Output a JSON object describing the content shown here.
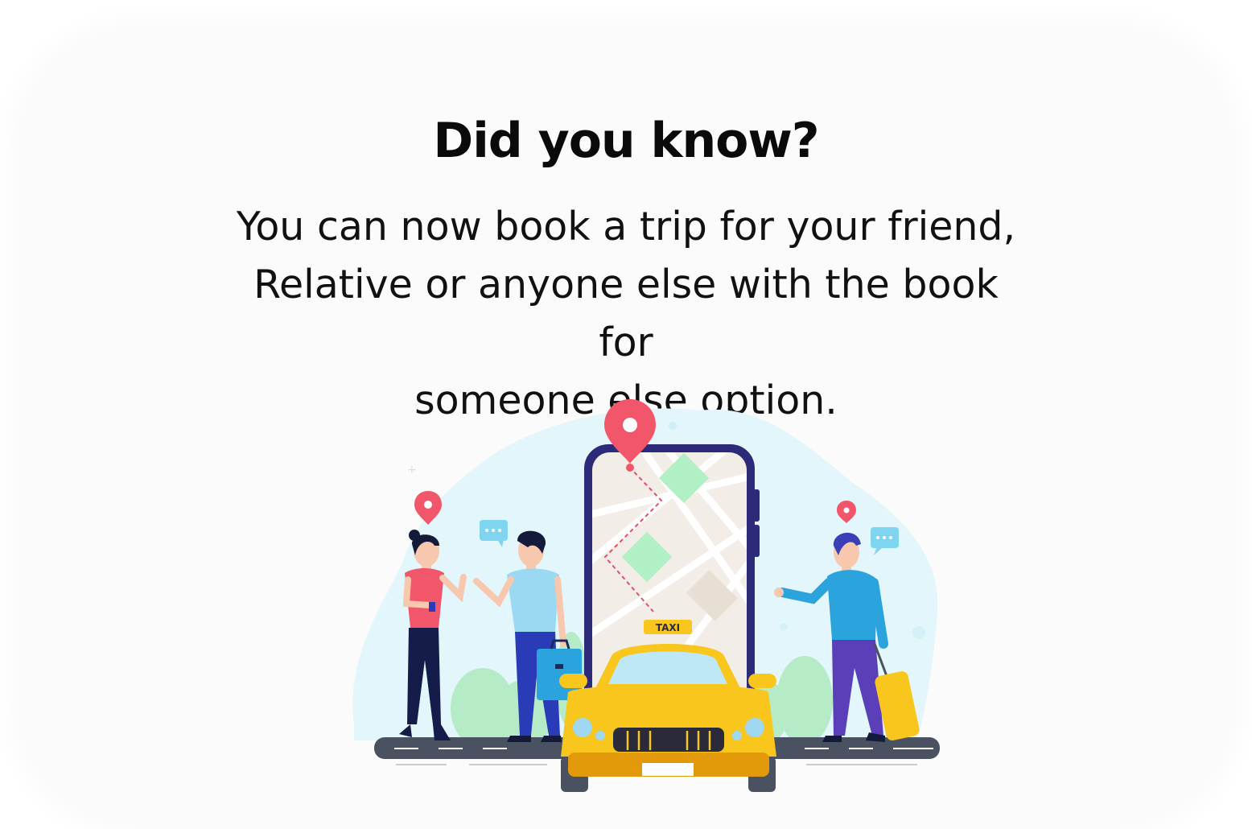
{
  "tip": {
    "title": "Did you know?",
    "message_line1": "You can now book a trip for your friend,",
    "message_line2": "Relative or anyone else with the book for",
    "message_line3": "someone else option."
  },
  "illustration": {
    "taxi_sign": "TAXI",
    "icons": [
      "map-pin-icon",
      "chat-bubble-icon",
      "smartphone-map-icon",
      "taxi-car-icon",
      "suitcase-icon",
      "briefcase-icon"
    ]
  },
  "colors": {
    "pin": "#f2566b",
    "phone_frame": "#2e2a7a",
    "taxi_yellow": "#f8c61d",
    "map_green": "#b6efc6",
    "sky_blue": "#e2f6fb",
    "road": "#4a5160"
  }
}
